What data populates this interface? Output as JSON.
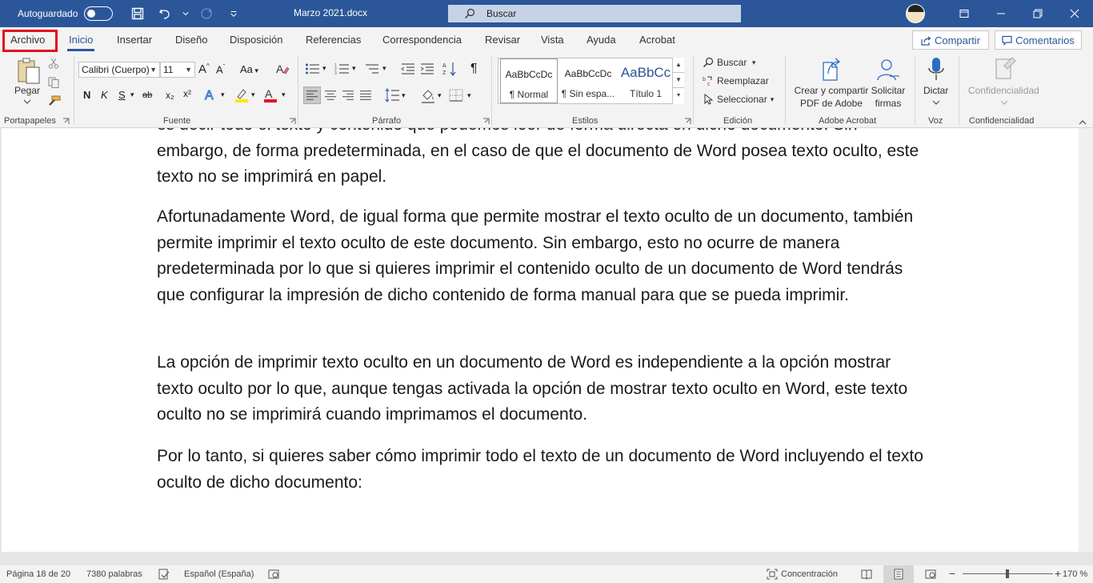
{
  "titlebar": {
    "autosave_label": "Autoguardado",
    "doc_title": "Marzo 2021.docx",
    "search_placeholder": "Buscar"
  },
  "tabs": {
    "file": "Archivo",
    "items": [
      "Inicio",
      "Insertar",
      "Diseño",
      "Disposición",
      "Referencias",
      "Correspondencia",
      "Revisar",
      "Vista",
      "Ayuda",
      "Acrobat"
    ],
    "active": "Inicio",
    "share": "Compartir",
    "comments": "Comentarios"
  },
  "ribbon": {
    "clipboard": {
      "paste": "Pegar",
      "label": "Portapapeles"
    },
    "font": {
      "name": "Calibri (Cuerpo)",
      "size": "11",
      "label": "Fuente",
      "change_case": "Aa",
      "bold": "N",
      "italic": "K",
      "underline": "S",
      "strike": "ab",
      "subscript": "x₂",
      "superscript": "x²"
    },
    "paragraph": {
      "label": "Párrafo"
    },
    "styles": {
      "label": "Estilos",
      "items": [
        {
          "sample": "AaBbCcDc",
          "name": "¶ Normal"
        },
        {
          "sample": "AaBbCcDc",
          "name": "¶ Sin espa..."
        },
        {
          "sample": "AaBbCc",
          "name": "Título 1"
        }
      ]
    },
    "editing": {
      "label": "Edición",
      "find": "Buscar",
      "replace": "Reemplazar",
      "select": "Seleccionar"
    },
    "acrobat": {
      "label": "Adobe Acrobat",
      "create_share": "Crear y compartir PDF de Adobe",
      "request_sign": "Solicitar firmas"
    },
    "voice": {
      "label": "Voz",
      "dictate": "Dictar"
    },
    "sensitivity": {
      "label": "Confidencialidad",
      "button": "Confidencialidad"
    }
  },
  "document": {
    "paragraphs": [
      "es decir todo el texto y contenido que podemos leer de forma directa en dicho documento. Sin embargo, de forma predeterminada, en el caso de que el documento de Word posea texto oculto, este texto no se imprimirá en papel.",
      "Afortunadamente Word, de igual forma que permite mostrar el texto oculto de un documento, también permite imprimir el texto oculto de este documento. Sin embargo, esto no ocurre de manera predeterminada por lo que si quieres imprimir el contenido oculto de un documento de Word tendrás que configurar la impresión de dicho contenido de forma manual para que se pueda imprimir.",
      "La opción de imprimir texto oculto en un documento de Word es independiente a la opción mostrar texto oculto por lo que, aunque tengas activada la opción de mostrar texto oculto en Word, este texto oculto no se imprimirá cuando imprimamos el documento.",
      "Por lo tanto, si quieres saber cómo imprimir todo el texto de un documento de Word incluyendo el texto oculto de dicho documento:"
    ]
  },
  "statusbar": {
    "page": "Página 18 de 20",
    "words": "7380 palabras",
    "language": "Español (España)",
    "focus": "Concentración",
    "zoom": "170 %",
    "zoom_min": "−",
    "zoom_plus": "+"
  },
  "colors": {
    "accent": "#2b579a",
    "highlight_box": "#e3101d"
  }
}
